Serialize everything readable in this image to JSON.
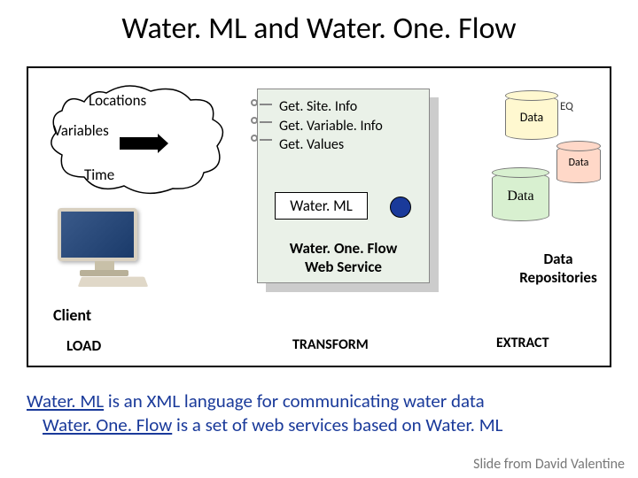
{
  "title": "Water. ML and Water. One. Flow",
  "cloud": {
    "locations": "Locations",
    "variables": "Variables",
    "time": "Time"
  },
  "client_label": "Client",
  "load_label": "LOAD",
  "service": {
    "methods": [
      "Get. Site. Info",
      "Get. Variable. Info",
      "Get. Values"
    ],
    "waterml": "Water. ML",
    "wofws_line1": "Water. One. Flow",
    "wofws_line2": "Web Service"
  },
  "etl": {
    "transform": "TRANSFORM",
    "extract": "EXTRACT"
  },
  "repos": {
    "title_line1": "Data",
    "title_line2": "Repositories",
    "cyl1": "Data",
    "cyl1_suffix": "EQ",
    "cyl2": "Data",
    "cyl3": "Data"
  },
  "caption": {
    "line1_a": "Water. ML",
    "line1_b": " is an XML language for communicating water data",
    "line2_a": "Water. One. Flow",
    "line2_b": " is a set of web services based on Water. ML"
  },
  "attribution": "Slide from David Valentine"
}
